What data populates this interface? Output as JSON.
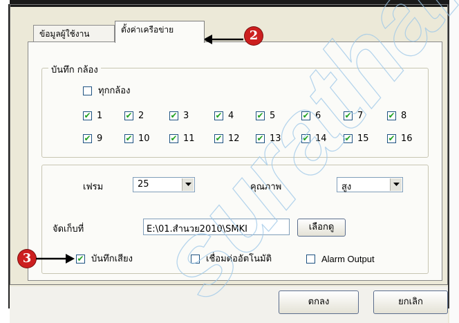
{
  "tabs": [
    {
      "label": "ข้อมูลผู้ใช้งาน"
    },
    {
      "label": "ตั้งค่าเครือข่าย"
    }
  ],
  "record_group": {
    "title": "บันทึก กล้อง",
    "all_cameras": {
      "label": "ทุกกล้อง",
      "checked": false
    },
    "cameras": [
      {
        "label": "1",
        "checked": true
      },
      {
        "label": "2",
        "checked": true
      },
      {
        "label": "3",
        "checked": true
      },
      {
        "label": "4",
        "checked": true
      },
      {
        "label": "5",
        "checked": true
      },
      {
        "label": "6",
        "checked": true
      },
      {
        "label": "7",
        "checked": true
      },
      {
        "label": "8",
        "checked": true
      },
      {
        "label": "9",
        "checked": true
      },
      {
        "label": "10",
        "checked": true
      },
      {
        "label": "11",
        "checked": true
      },
      {
        "label": "12",
        "checked": true
      },
      {
        "label": "13",
        "checked": true
      },
      {
        "label": "14",
        "checked": true
      },
      {
        "label": "15",
        "checked": true
      },
      {
        "label": "16",
        "checked": true
      }
    ]
  },
  "settings": {
    "frame_label": "เฟรม",
    "frame_value": "25",
    "quality_label": "คุณภาพ",
    "quality_value": "สูง",
    "storage_label": "จัดเก็บที่",
    "storage_value": "E:\\01.สำนวย2010\\SMKI",
    "browse_label": "เลือกดู",
    "record_audio": {
      "label": "บันทึกเสียง",
      "checked": true
    },
    "auto_connect": {
      "label": "เชื่อมต่ออัตโนมัติ",
      "checked": false
    },
    "alarm_output": {
      "label": "Alarm Output",
      "checked": false
    }
  },
  "buttons": {
    "ok_label": "ตกลง",
    "cancel_label": "ยกเลิก"
  },
  "callouts": {
    "step_2": "2",
    "step_3": "3"
  },
  "watermark": "surathai.com",
  "colors": {
    "dialog_bg": "#ece9d8",
    "panel_bg": "#fbfbf8",
    "check_mark": "#21a121",
    "callout": "#cc1f1f"
  }
}
